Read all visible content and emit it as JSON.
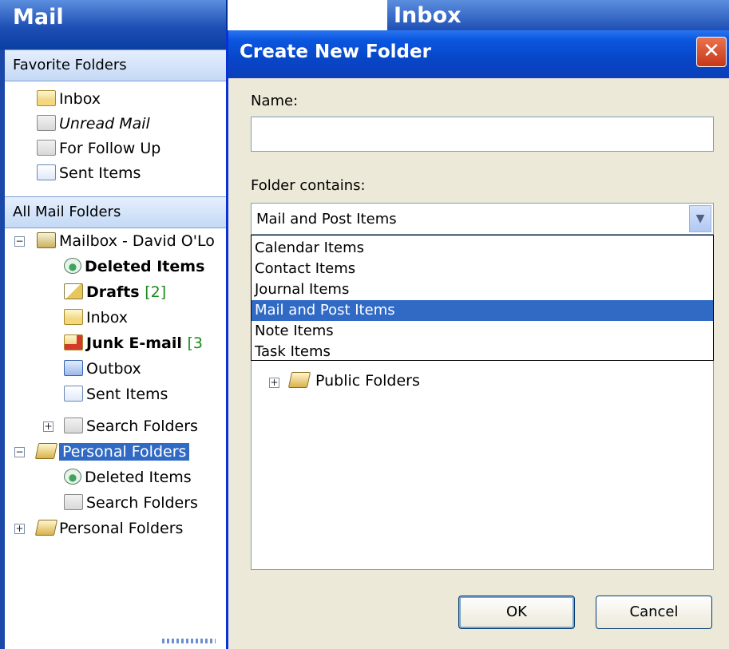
{
  "nav": {
    "title": "Mail",
    "favorites_header": "Favorite Folders",
    "favorites": [
      {
        "label": "Inbox",
        "icon": "inbox-icon"
      },
      {
        "label": "Unread Mail",
        "icon": "search-folder-icon"
      },
      {
        "label": "For Follow Up",
        "icon": "search-folder-icon"
      },
      {
        "label": "Sent Items",
        "icon": "sent-items-icon"
      }
    ],
    "all_header": "All Mail Folders",
    "tree": {
      "mailbox": "Mailbox - David O'Lo",
      "deleted": "Deleted Items",
      "drafts": "Drafts",
      "drafts_count": "[2]",
      "inbox": "Inbox",
      "junk": "Junk E-mail",
      "junk_count": "[3",
      "outbox": "Outbox",
      "sent": "Sent Items",
      "search": "Search Folders",
      "personal1": "Personal Folders",
      "p_deleted": "Deleted Items",
      "p_search": "Search Folders",
      "personal2": "Personal Folders"
    }
  },
  "inbox_header": "Inbox",
  "dialog": {
    "title": "Create New Folder",
    "close_glyph": "✕",
    "name_label": "Name:",
    "name_value": "",
    "contains_label": "Folder contains:",
    "contains_value": "Mail and Post Items",
    "options": [
      "Calendar Items",
      "Contact Items",
      "Journal Items",
      "Mail and Post Items",
      "Note Items",
      "Task Items"
    ],
    "selected_option": "Mail and Post Items",
    "tree_item": "Public Folders",
    "ok_label": "OK",
    "cancel_label": "Cancel"
  },
  "colors": {
    "titlebar": "#0a56e0",
    "selection": "#316ac5",
    "dialog_bg": "#ece9d8",
    "count_green": "#1a8a1a"
  }
}
